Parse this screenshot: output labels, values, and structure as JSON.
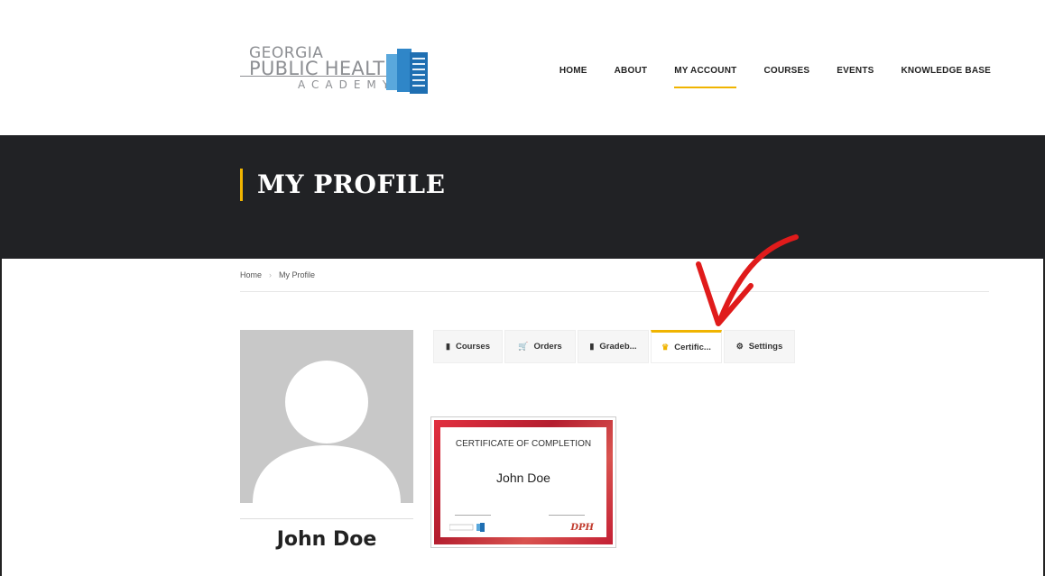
{
  "logo": {
    "line1": "GEORGIA",
    "line2": "PUBLIC HEALTH",
    "line3": "ACADEMY"
  },
  "nav": [
    {
      "label": "HOME",
      "active": false
    },
    {
      "label": "ABOUT",
      "active": false
    },
    {
      "label": "MY ACCOUNT",
      "active": true
    },
    {
      "label": "COURSES",
      "active": false
    },
    {
      "label": "EVENTS",
      "active": false
    },
    {
      "label": "KNOWLEDGE BASE",
      "active": false
    }
  ],
  "banner": {
    "title": "MY PROFILE"
  },
  "breadcrumb": {
    "home": "Home",
    "current": "My Profile",
    "separator": "›"
  },
  "profile": {
    "name": "John Doe"
  },
  "tabs": [
    {
      "label": "Courses",
      "icon": "book-icon"
    },
    {
      "label": "Orders",
      "icon": "cart-icon"
    },
    {
      "label": "Gradeb...",
      "icon": "book-icon"
    },
    {
      "label": "Certific...",
      "icon": "crown-icon"
    },
    {
      "label": "Settings",
      "icon": "gear-icon"
    }
  ],
  "certificate": {
    "title": "CERTIFICATE OF COMPLETION",
    "name": "John Doe",
    "mark": "DPH"
  },
  "colors": {
    "accent": "#f0b400",
    "banner": "#212225",
    "arrow": "#e01b1b"
  }
}
